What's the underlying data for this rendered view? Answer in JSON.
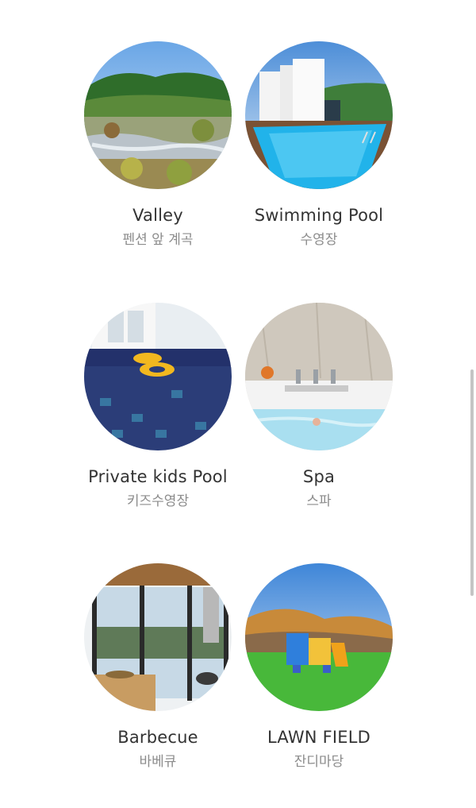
{
  "facilities": [
    {
      "title": "Valley",
      "subtitle": "펜션 앞 계곡",
      "image": "valley-photo"
    },
    {
      "title": "Swimming Pool",
      "subtitle": "수영장",
      "image": "swimming-pool-photo"
    },
    {
      "title": "Private kids Pool",
      "subtitle": "키즈수영장",
      "image": "kids-pool-photo"
    },
    {
      "title": "Spa",
      "subtitle": "스파",
      "image": "spa-photo"
    },
    {
      "title": "Barbecue",
      "subtitle": "바베큐",
      "image": "barbecue-photo"
    },
    {
      "title": "LAWN FIELD",
      "subtitle": "잔디마당",
      "image": "lawn-field-photo"
    }
  ],
  "colors": {
    "title": "#333333",
    "subtitle": "#8c8c8c",
    "background": "#ffffff"
  }
}
